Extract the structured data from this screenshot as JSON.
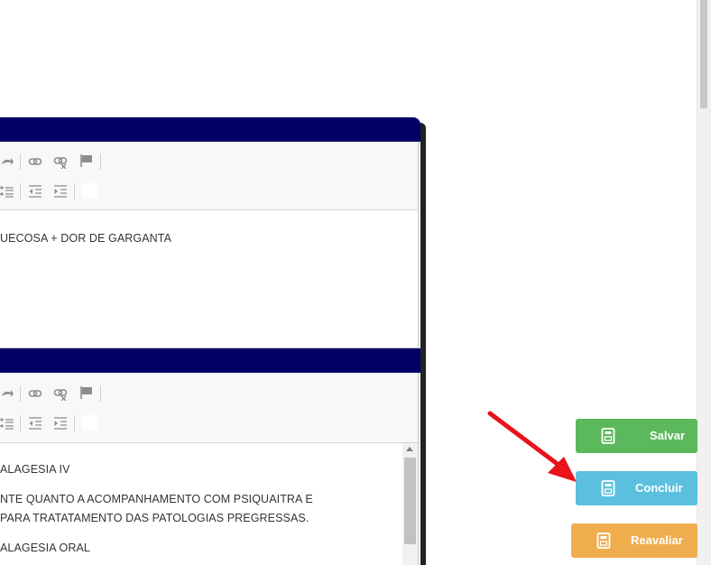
{
  "editor1": {
    "lines": [
      "UECOSA + DOR DE GARGANTA"
    ]
  },
  "editor2": {
    "lines": [
      "ALAGESIA IV",
      "NTE QUANTO A ACOMPANHAMENTO COM PSIQUAITRA E",
      "PARA TRATATAMENTO DAS PATOLOGIAS PREGRESSAS.",
      "ALAGESIA ORAL"
    ]
  },
  "actions": {
    "salvar": "Salvar",
    "concluir": "Concluir",
    "reavaliar": "Reavaliar"
  },
  "colors": {
    "panel_header": "#000066",
    "salvar": "#5cb85c",
    "concluir": "#5bc0de",
    "reavaliar": "#f0ad4e",
    "annotation_arrow": "#e8131b"
  },
  "icons": [
    "redo-icon",
    "link-icon",
    "unlink-icon",
    "flag-icon",
    "bullet-list-icon",
    "outdent-icon",
    "indent-icon",
    "save-icon"
  ]
}
